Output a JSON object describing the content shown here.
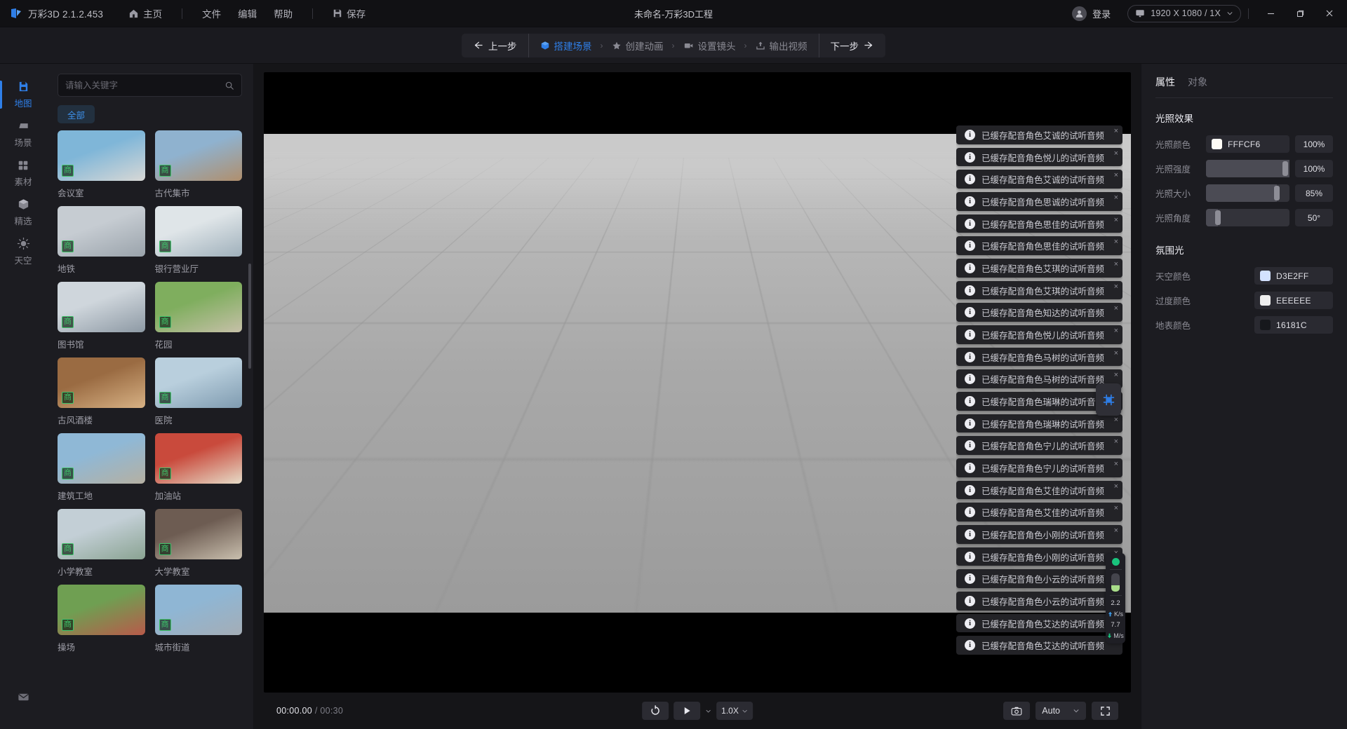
{
  "titlebar": {
    "brand": "万彩3D 2.1.2.453",
    "home": "主页",
    "menus": [
      "文件",
      "编辑",
      "帮助"
    ],
    "save": "保存",
    "doc_title": "未命名-万彩3D工程",
    "account": "登录",
    "resolution": "1920 X 1080 / 1X",
    "icons": {
      "logo": "app-logo-icon",
      "home": "home-icon",
      "save": "save-icon",
      "avatar": "user-avatar-icon",
      "monitor": "monitor-icon",
      "chevron": "chevron-down-icon",
      "minimize": "minimize-icon",
      "maximize": "restore-icon",
      "close": "close-icon"
    }
  },
  "stepbar": {
    "prev": "上一步",
    "next": "下一步",
    "steps": [
      {
        "label": "搭建场景",
        "icon": "cube-icon",
        "active": true
      },
      {
        "label": "创建动画",
        "icon": "star-icon",
        "active": false
      },
      {
        "label": "设置镜头",
        "icon": "video-camera-icon",
        "active": false
      },
      {
        "label": "输出视频",
        "icon": "export-icon",
        "active": false
      }
    ],
    "separator": "›"
  },
  "rail": {
    "items": [
      {
        "label": "地图",
        "icon": "map-icon",
        "active": true
      },
      {
        "label": "场景",
        "icon": "scene-icon",
        "active": false
      },
      {
        "label": "素材",
        "icon": "assets-grid-icon",
        "active": false
      },
      {
        "label": "精选",
        "icon": "featured-cube-icon",
        "active": false
      },
      {
        "label": "天空",
        "icon": "sun-icon",
        "active": false
      }
    ],
    "bottom": {
      "icon": "inbox-icon",
      "label": ""
    }
  },
  "library": {
    "search_placeholder": "请输入关键字",
    "search_value": "",
    "search_icon": "search-icon",
    "filters": [
      {
        "label": "全部",
        "active": true
      }
    ],
    "badge_text": "商",
    "cards": [
      {
        "label": "会议室",
        "c1": "#7fb6d8",
        "c2": "#d8d8d6"
      },
      {
        "label": "古代集市",
        "c1": "#8fb2cf",
        "c2": "#b08f6d"
      },
      {
        "label": "地铁",
        "c1": "#c6ccd2",
        "c2": "#9aa3ab"
      },
      {
        "label": "银行营业厅",
        "c1": "#dfe5e8",
        "c2": "#9fb0bb"
      },
      {
        "label": "图书馆",
        "c1": "#cfd6dc",
        "c2": "#8d99a4"
      },
      {
        "label": "花园",
        "c1": "#7fae5e",
        "c2": "#c6c0a8"
      },
      {
        "label": "古风酒楼",
        "c1": "#9a6b42",
        "c2": "#d7b184"
      },
      {
        "label": "医院",
        "c1": "#b9cfdd",
        "c2": "#7f9bb0"
      },
      {
        "label": "建筑工地",
        "c1": "#8fb8d6",
        "c2": "#b5b0a2"
      },
      {
        "label": "加油站",
        "c1": "#c94a3c",
        "c2": "#e6dcc8"
      },
      {
        "label": "小学教室",
        "c1": "#c3cfd6",
        "c2": "#8aa392"
      },
      {
        "label": "大学教室",
        "c1": "#6d5c52",
        "c2": "#c9bfae"
      },
      {
        "label": "操场",
        "c1": "#6f9f52",
        "c2": "#b85a4a"
      },
      {
        "label": "城市街道",
        "c1": "#8fb6d4",
        "c2": "#a4adb6"
      }
    ]
  },
  "toasts": {
    "info_icon": "info-icon",
    "close_icon": "close-icon",
    "items": [
      "已缓存配音角色艾诚的试听音频",
      "已缓存配音角色悦儿的试听音频",
      "已缓存配音角色艾诚的试听音频",
      "已缓存配音角色思诚的试听音频",
      "已缓存配音角色思佳的试听音频",
      "已缓存配音角色思佳的试听音频",
      "已缓存配音角色艾琪的试听音频",
      "已缓存配音角色艾琪的试听音频",
      "已缓存配音角色知达的试听音频",
      "已缓存配音角色悦儿的试听音频",
      "已缓存配音角色马树的试听音频",
      "已缓存配音角色马树的试听音频",
      "已缓存配音角色瑞琳的试听音频",
      "已缓存配音角色瑞琳的试听音频",
      "已缓存配音角色宁儿的试听音频",
      "已缓存配音角色宁儿的试听音频",
      "已缓存配音角色艾佳的试听音频",
      "已缓存配音角色艾佳的试听音频",
      "已缓存配音角色小刚的试听音频",
      "已缓存配音角色小刚的试听音频",
      "已缓存配音角色小云的试听音频",
      "已缓存配音角色小云的试听音频",
      "已缓存配音角色艾达的试听音频",
      "已缓存配音角色艾达的试听音频"
    ]
  },
  "gizmo": {
    "icon": "transform-gizmo-icon"
  },
  "netstats": {
    "status_dot_color": "#19c37d",
    "battery_level": "35%",
    "upload_value": "2.2",
    "upload_unit": "K/s",
    "download_value": "7.7",
    "download_unit": "M/s"
  },
  "transport": {
    "current_time": "00:00.00",
    "separator": "/",
    "total_time": "00:30",
    "loop_icon": "loop-icon",
    "play_icon": "play-icon",
    "caret_icon": "chevron-down-icon",
    "speed": "1.0X",
    "camera_icon": "camera-icon",
    "quality": "Auto",
    "fullscreen_icon": "fullscreen-icon"
  },
  "inspector": {
    "tabs": [
      {
        "label": "属性",
        "active": true
      },
      {
        "label": "对象",
        "active": false
      }
    ],
    "lighting": {
      "title": "光照效果",
      "rows": [
        {
          "label": "光照颜色",
          "type": "color",
          "hex": "FFFCF6",
          "swatch": "#FFFCF6",
          "value": "100%"
        },
        {
          "label": "光照强度",
          "type": "slider",
          "percent": 100,
          "value": "100%"
        },
        {
          "label": "光照大小",
          "type": "slider",
          "percent": 85,
          "value": "85%"
        },
        {
          "label": "光照角度",
          "type": "slider",
          "percent": 14,
          "value": "50°"
        }
      ]
    },
    "ambient": {
      "title": "氛围光",
      "rows": [
        {
          "label": "天空颜色",
          "hex": "D3E2FF",
          "swatch": "#D3E2FF"
        },
        {
          "label": "过度颜色",
          "hex": "EEEEEE",
          "swatch": "#EEEEEE"
        },
        {
          "label": "地表颜色",
          "hex": "16181C",
          "swatch": "#16181C"
        }
      ]
    }
  }
}
